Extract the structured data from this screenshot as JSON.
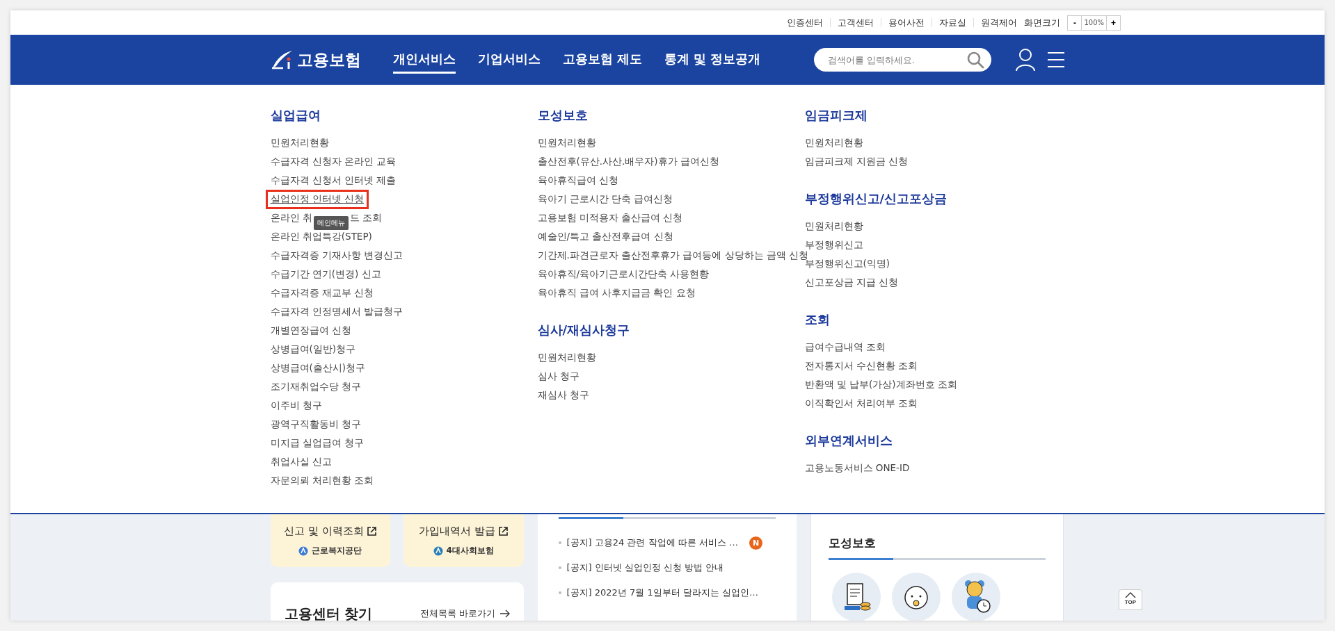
{
  "utility_links": [
    "인증센터",
    "고객센터",
    "용어사전",
    "자료실",
    "원격제어"
  ],
  "zoom_control": {
    "label": "화면크기",
    "minus": "-",
    "value": "100%",
    "plus": "+"
  },
  "header": {
    "logo_text": "고용보험",
    "nav": [
      {
        "label": "개인서비스",
        "selected": true
      },
      {
        "label": "기업서비스",
        "selected": false
      },
      {
        "label": "고용보험 제도",
        "selected": false
      },
      {
        "label": "통계 및 정보공개",
        "selected": false
      }
    ],
    "search": {
      "placeholder": "검색어를 입력하세요."
    }
  },
  "mega_menu": {
    "columns": [
      {
        "sections": [
          {
            "title": "실업급여",
            "items": [
              {
                "kind": "link",
                "label": "민원처리현황",
                "focused": false
              },
              {
                "kind": "link",
                "label": "수급자격 신청자 온라인 교육",
                "focused": false
              },
              {
                "kind": "link",
                "label": "수급자격 신청서 인터넷 제출",
                "focused": false
              },
              {
                "kind": "link",
                "label": "실업인정 인터넷 신청",
                "focused": true
              },
              {
                "kind": "covered",
                "label": "온라인 취",
                "label_after": "드 조회",
                "tooltip": "메인메뉴",
                "focused": false
              },
              {
                "kind": "link",
                "label": "온라인 취업특강(STEP)",
                "focused": false
              },
              {
                "kind": "link",
                "label": "수급자격증 기재사항 변경신고",
                "focused": false
              },
              {
                "kind": "link",
                "label": "수급기간 연기(변경) 신고",
                "focused": false
              },
              {
                "kind": "link",
                "label": "수급자격증 재교부 신청",
                "focused": false
              },
              {
                "kind": "link",
                "label": "수급자격 인정명세서 발급청구",
                "focused": false
              },
              {
                "kind": "link",
                "label": "개별연장급여 신청",
                "focused": false
              },
              {
                "kind": "link",
                "label": "상병급여(일반)청구",
                "focused": false
              },
              {
                "kind": "link",
                "label": "상병급여(출산시)청구",
                "focused": false
              },
              {
                "kind": "link",
                "label": "조기재취업수당 청구",
                "focused": false
              },
              {
                "kind": "link",
                "label": "이주비 청구",
                "focused": false
              },
              {
                "kind": "link",
                "label": "광역구직활동비 청구",
                "focused": false
              },
              {
                "kind": "link",
                "label": "미지급 실업급여 청구",
                "focused": false
              },
              {
                "kind": "link",
                "label": "취업사실 신고",
                "focused": false
              },
              {
                "kind": "link",
                "label": "자문의뢰 처리현황 조회",
                "focused": false
              }
            ]
          }
        ]
      },
      {
        "sections": [
          {
            "title": "모성보호",
            "items": [
              {
                "kind": "link",
                "label": "민원처리현황",
                "focused": false
              },
              {
                "kind": "link",
                "label": "출산전후(유산.사산.배우자)휴가 급여신청",
                "focused": false
              },
              {
                "kind": "link",
                "label": "육아휴직급여 신청",
                "focused": false
              },
              {
                "kind": "link",
                "label": "육아기 근로시간 단축 급여신청",
                "focused": false
              },
              {
                "kind": "link",
                "label": "고용보험 미적용자 출산급여 신청",
                "focused": false
              },
              {
                "kind": "link",
                "label": "예술인/특고 출산전후급여 신청",
                "focused": false
              },
              {
                "kind": "link",
                "label": "기간제.파견근로자 출산전후휴가 급여등에 상당하는 금액 신청",
                "focused": false
              },
              {
                "kind": "link",
                "label": "육아휴직/육아기근로시간단축 사용현황",
                "focused": false
              },
              {
                "kind": "link",
                "label": "육아휴직 급여 사후지급금 확인 요청",
                "focused": false
              }
            ]
          },
          {
            "title": "심사/재심사청구",
            "items": [
              {
                "kind": "link",
                "label": "민원처리현황",
                "focused": false
              },
              {
                "kind": "link",
                "label": "심사 청구",
                "focused": false
              },
              {
                "kind": "link",
                "label": "재심사 청구",
                "focused": false
              }
            ]
          }
        ]
      },
      {
        "sections": [
          {
            "title": "임금피크제",
            "items": [
              {
                "kind": "link",
                "label": "민원처리현황",
                "focused": false
              },
              {
                "kind": "link",
                "label": "임금피크제 지원금 신청",
                "focused": false
              }
            ]
          },
          {
            "title": "부정행위신고/신고포상금",
            "items": [
              {
                "kind": "link",
                "label": "민원처리현황",
                "focused": false
              },
              {
                "kind": "link",
                "label": "부정행위신고",
                "focused": false
              },
              {
                "kind": "link",
                "label": "부정행위신고(익명)",
                "focused": false
              },
              {
                "kind": "link",
                "label": "신고포상금 지급 신청",
                "focused": false
              }
            ]
          },
          {
            "title": "조회",
            "items": [
              {
                "kind": "link",
                "label": "급여수급내역 조회",
                "focused": false
              },
              {
                "kind": "link",
                "label": "전자통지서 수신현황 조회",
                "focused": false
              },
              {
                "kind": "link",
                "label": "반환액 및 납부(가상)계좌번호 조회",
                "focused": false
              },
              {
                "kind": "link",
                "label": "이직확인서 처리여부 조회",
                "focused": false
              }
            ]
          },
          {
            "title": "외부연계서비스",
            "items": [
              {
                "kind": "link",
                "label": "고용노동서비스 ONE-ID",
                "focused": false
              }
            ]
          }
        ]
      }
    ]
  },
  "quick_cards": [
    {
      "label": "신고 및 이력조회",
      "org": "근로복지공단"
    },
    {
      "label": "가입내역서 발급",
      "org": "4대사회보험"
    }
  ],
  "center_finder": {
    "title": "고용센터 찾기",
    "link": "전체목록 바로가기"
  },
  "notices": [
    {
      "text": "[공지] 고용24 관련 작업에 따른 서비스 …",
      "badge": "N"
    },
    {
      "text": "[공지] 인터넷 실업인정 신청 방법 안내"
    },
    {
      "text": "[공지] 2022년 7월 1일부터 달라지는 실업인…"
    }
  ],
  "maternity_panel": {
    "title": "모성보호"
  },
  "top_button": {
    "label": "TOP"
  }
}
